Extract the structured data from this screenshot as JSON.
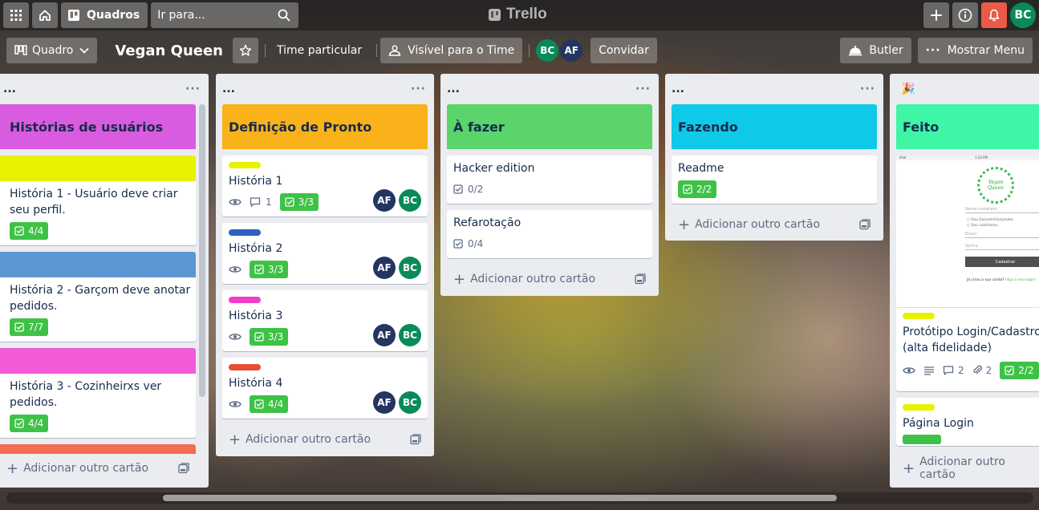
{
  "topbar": {
    "boards_label": "Quadros",
    "search_placeholder": "Ir para...",
    "logo_text": "Trello",
    "user_initials": "BC"
  },
  "boardbar": {
    "view_label": "Quadro",
    "board_title": "Vegan Queen",
    "team_label": "Time particular",
    "visibility_label": "Visível para o Time",
    "member_bc": "BC",
    "member_af": "AF",
    "invite_label": "Convidar",
    "butler_label": "Butler",
    "menu_label": "Mostrar Menu"
  },
  "lists": [
    {
      "header": "...",
      "cover_title": "Histórias de usuários",
      "cover_color": "#d95ce0",
      "cards": [
        {
          "label_color": "#e6f200",
          "title": "História 1 - Usuário deve criar seu perfil.",
          "checklist": "4/4"
        },
        {
          "label_color": "#5c96d2",
          "title": "História 2 - Garçom deve anotar pedidos.",
          "checklist": "7/7"
        },
        {
          "label_color": "#f25ad8",
          "title": "História 3 - Cozinheirxs ver pedidos.",
          "checklist": "4/4"
        },
        {
          "label_color": "#f46a53",
          "title": "",
          "checklist": ""
        }
      ],
      "add_label": "Adicionar outro cartão"
    },
    {
      "header": "...",
      "cover_title": "Definição de Pronto",
      "cover_color": "#f9b21a",
      "cards": [
        {
          "label_color": "#e6f200",
          "title": "História 1",
          "comments": "1",
          "checklist": "3/3",
          "members": [
            "AF",
            "BC"
          ]
        },
        {
          "label_color": "#2f5fbe",
          "title": "História 2",
          "checklist": "3/3",
          "members": [
            "AF",
            "BC"
          ]
        },
        {
          "label_color": "#f03cc8",
          "title": "História 3",
          "checklist": "3/3",
          "members": [
            "AF",
            "BC"
          ]
        },
        {
          "label_color": "#ea4c37",
          "title": "História 4",
          "checklist": "4/4",
          "members": [
            "AF",
            "BC"
          ]
        }
      ],
      "add_label": "Adicionar outro cartão"
    },
    {
      "header": "...",
      "cover_title": "À fazer",
      "cover_color": "#5ad46b",
      "cards": [
        {
          "title": "Hacker edition",
          "checklist": "0/2"
        },
        {
          "title": "Refarotação",
          "checklist": "0/4"
        }
      ],
      "add_label": "Adicionar outro cartão"
    },
    {
      "header": "...",
      "cover_title": "Fazendo",
      "cover_color": "#0fc9e8",
      "cards": [
        {
          "title": "Readme",
          "checklist": "2/2"
        }
      ],
      "add_label": "Adicionar outro cartão"
    },
    {
      "header": "🎉",
      "cover_title": "Feito",
      "cover_color": "#3ff5a6",
      "cards": [
        {
          "label_color": "#e6f200",
          "title": "Protótipo Login/Cadastro (alta fidelidade)",
          "comments": "2",
          "attachments": "2",
          "checklist": "2/2"
        },
        {
          "label_color": "#e6f200",
          "title": "Página Login"
        }
      ],
      "add_label": "Adicionar outro cartão"
    }
  ],
  "prototype": {
    "status_left": "iPad",
    "status_time": "1:20 PM",
    "logo_text": "Vegan Queen",
    "field_name": "Nome completo",
    "radio_1": "Sou Garçom/Garçonete",
    "radio_2": "Sou cozinheirx",
    "field_email": "Email",
    "field_password": "Senha",
    "submit": "Cadastrar",
    "footer": "Já criou a sua conta?",
    "footer_link": "Faça o seu login!"
  }
}
